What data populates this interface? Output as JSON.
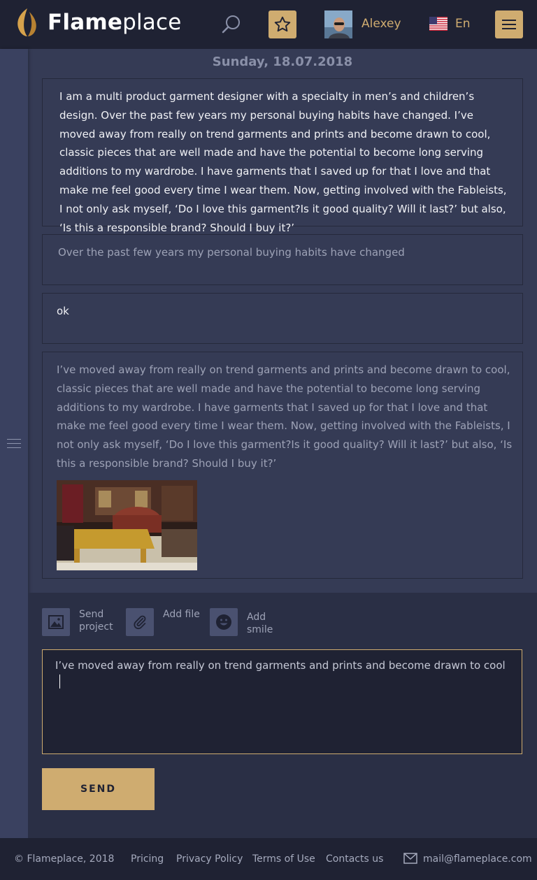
{
  "header": {
    "logo_bold": "Flame",
    "logo_light": "place",
    "user_name": "Alexey",
    "language": "En"
  },
  "feed": {
    "date": "Sunday, 18.07.2018",
    "messages": [
      {
        "text": "I am a multi product garment designer with a specialty in men’s and children’s design. Over the past few years my personal buying habits have changed. I’ve moved away from really on trend garments and prints and become drawn to cool, classic pieces that are well made and have the potential to become long serving additions to my wardrobe. I have garments that I saved up for that I love and that make me feel good every time I wear them. Now, getting involved with the Fableists, I not only ask myself, ‘Do I love this garment?Is it good quality? Will it last?’ but also, ‘Is this a responsible brand? Should I buy it?’"
      },
      {
        "text": "Over the past few years my personal buying habits have changed"
      },
      {
        "text": "ok"
      },
      {
        "text": "I’ve moved away from really on trend garments and prints and become drawn to cool, classic pieces that are well made and have the potential to become long serving additions to my wardrobe. I have garments that I saved up for that I love and that make me feel good every time I wear them. Now, getting involved with the Fableists, I not only ask myself, ‘Do I love this garment?Is it good quality? Will it last?’ but also, ‘Is this a responsible brand? Should I buy it?’"
      }
    ]
  },
  "composer": {
    "tools": [
      {
        "label": "Send project",
        "icon": "image-icon"
      },
      {
        "label": "Add file",
        "icon": "paperclip-icon"
      },
      {
        "label": "Add smile",
        "icon": "smile-icon"
      }
    ],
    "input_value": "I’ve moved away from really on trend garments and prints and become drawn to cool",
    "send_label": "SEND"
  },
  "footer": {
    "copyright": "© Flameplace, 2018",
    "links": [
      "Pricing",
      "Privacy Policy",
      "Terms of Use",
      "Contacts us"
    ],
    "email": "mail@flameplace.com"
  },
  "colors": {
    "accent": "#cfac70",
    "header_bg": "#1f2233",
    "page_bg": "#353b55"
  }
}
